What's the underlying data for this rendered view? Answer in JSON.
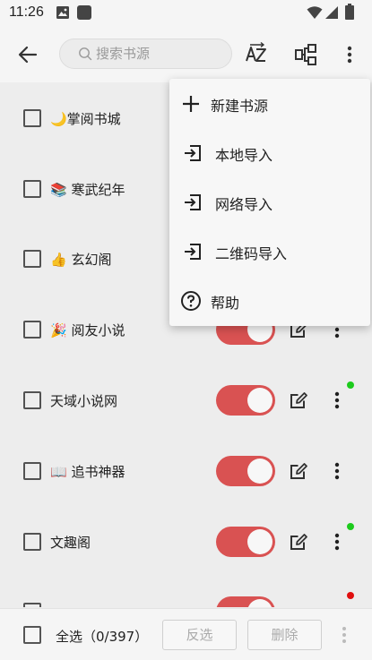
{
  "status_bar": {
    "time": "11:26"
  },
  "toolbar": {
    "search_placeholder": "搜索书源"
  },
  "sources": [
    {
      "name": "🌙掌阅书城",
      "enabled": true,
      "dot": ""
    },
    {
      "name": "📚 寒武纪年",
      "enabled": true,
      "dot": ""
    },
    {
      "name": "👍 玄幻阁",
      "enabled": true,
      "dot": ""
    },
    {
      "name": "🎉 阅友小说",
      "enabled": true,
      "dot": ""
    },
    {
      "name": "天域小说网",
      "enabled": true,
      "dot": "#1ed21e"
    },
    {
      "name": "📖 追书神器",
      "enabled": true,
      "dot": ""
    },
    {
      "name": "文趣阁",
      "enabled": true,
      "dot": "#1ed21e"
    },
    {
      "name": "",
      "enabled": true,
      "dot": "#e81010"
    }
  ],
  "bottom_bar": {
    "select_all_label": "全选（0/397）",
    "invert_label": "反选",
    "delete_label": "删除"
  },
  "menu": {
    "items": [
      {
        "label": "新建书源",
        "icon": "plus-icon"
      },
      {
        "label": "本地导入",
        "icon": "import-icon"
      },
      {
        "label": "网络导入",
        "icon": "import-icon"
      },
      {
        "label": "二维码导入",
        "icon": "import-icon"
      },
      {
        "label": "帮助",
        "icon": "help-icon"
      }
    ]
  },
  "colors": {
    "switch_on": "#e05555",
    "dot_green": "#1ed21e",
    "dot_red": "#e81010"
  }
}
